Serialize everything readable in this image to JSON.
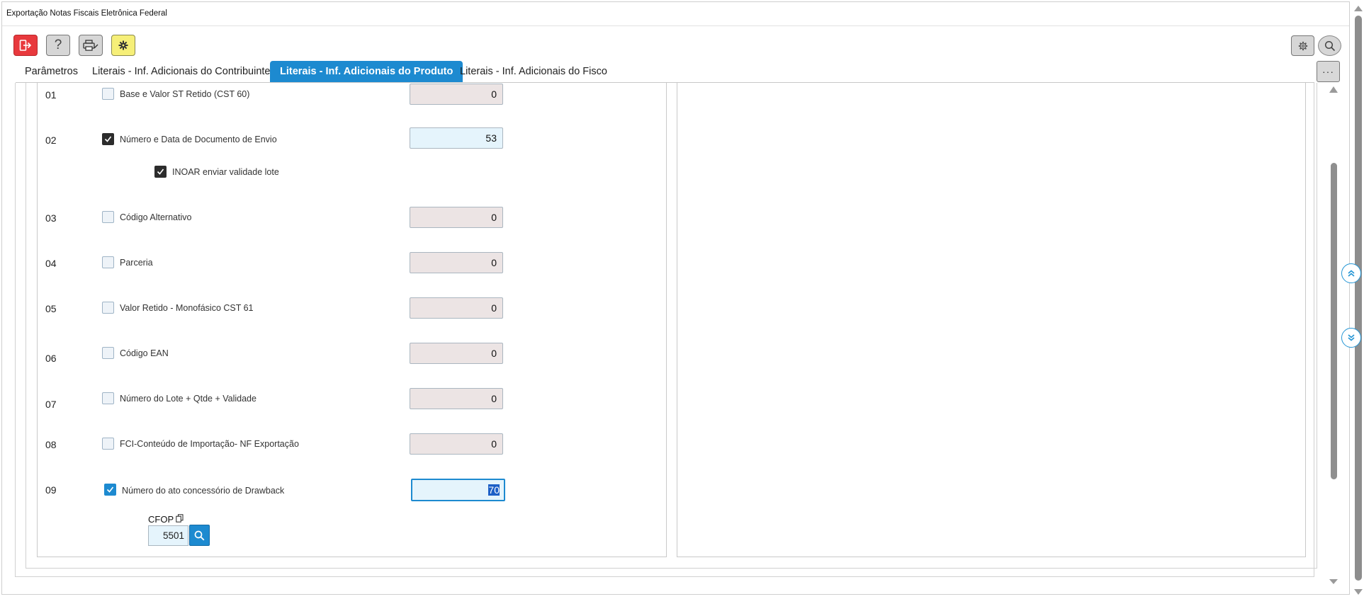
{
  "window": {
    "title": "Exportação Notas Fiscais Eletrônica Federal"
  },
  "toolbar": {
    "exit_icon": "exit-icon",
    "help_glyph": "?",
    "print_icon": "printer-icon",
    "star_icon": "gear-star-icon",
    "settings_icon": "gear-icon",
    "search_icon": "search-icon",
    "more_glyph": "···"
  },
  "tabs": [
    {
      "label": "Parâmetros",
      "active": false
    },
    {
      "label": "Literais - Inf. Adicionais do Contribuinte",
      "active": false
    },
    {
      "label": "Literais - Inf. Adicionais do Produto",
      "active": true
    },
    {
      "label": "Literais - Inf. Adicionais do Fisco",
      "active": false
    }
  ],
  "rows": [
    {
      "num": "01",
      "label": "Base e Valor ST Retido (CST 60)",
      "checked": false,
      "value": "0"
    },
    {
      "num": "02",
      "label": "Número e Data de Documento de Envio",
      "checked": true,
      "value": "53"
    },
    {
      "sub_label": "INOAR enviar validade lote",
      "sub_checked": true
    },
    {
      "num": "03",
      "label": "Código Alternativo",
      "checked": false,
      "value": "0"
    },
    {
      "num": "04",
      "label": "Parceria",
      "checked": false,
      "value": "0"
    },
    {
      "num": "05",
      "label": "Valor Retido - Monofásico CST 61",
      "checked": false,
      "value": "0"
    },
    {
      "num": "06",
      "label": "Código EAN",
      "checked": false,
      "value": "0"
    },
    {
      "num": "07",
      "label": "Número do Lote + Qtde + Validade",
      "checked": false,
      "value": "0"
    },
    {
      "num": "08",
      "label": "FCI-Conteúdo de Importação- NF Exportação",
      "checked": false,
      "value": "0"
    },
    {
      "num": "09",
      "label": "Número do ato concessório de Drawback",
      "checked": true,
      "value": "70"
    }
  ],
  "cfop": {
    "label": "CFOP",
    "value": "5501"
  },
  "colors": {
    "accent": "#1d8ad0",
    "exit": "#e8393d",
    "star": "#f6ef78"
  }
}
